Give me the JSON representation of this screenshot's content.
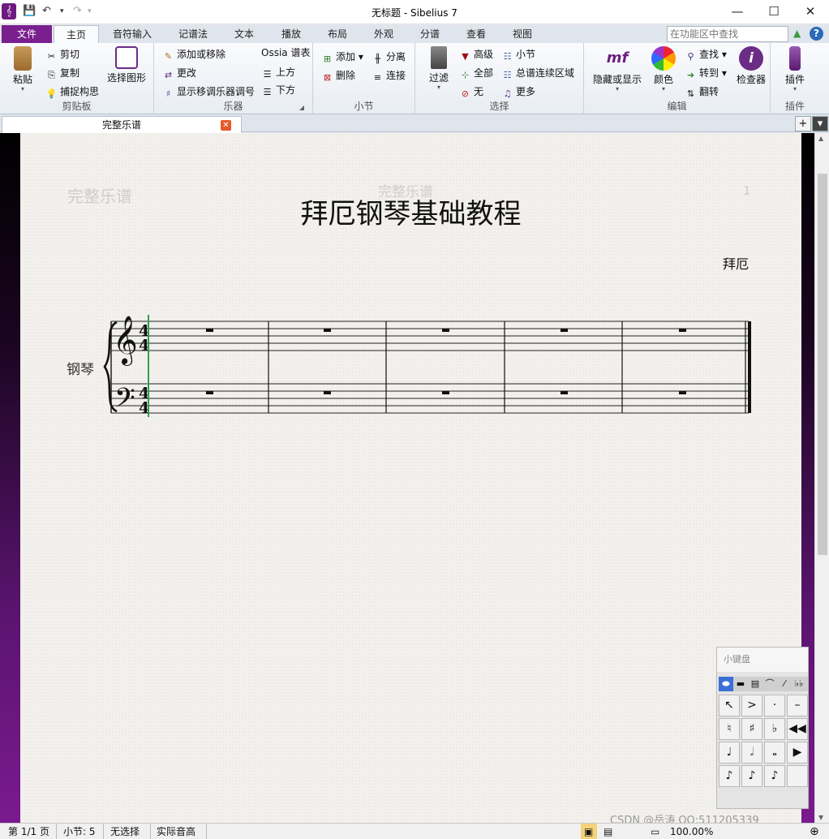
{
  "window": {
    "title": "无标题 - Sibelius 7",
    "minimize": "—",
    "maximize": "☐",
    "close": "✕"
  },
  "quick_access": {
    "undo_dd": "▾",
    "redo_dd": "▾",
    "more_dd": "▾"
  },
  "ribbon_tabs": {
    "file": "文件",
    "items": [
      "主页",
      "音符输入",
      "记谱法",
      "文本",
      "播放",
      "布局",
      "外观",
      "分谱",
      "查看",
      "视图"
    ],
    "active_index": 0
  },
  "search": {
    "placeholder": "在功能区中查找"
  },
  "groups": {
    "clipboard": {
      "label": "剪贴板",
      "paste": "粘贴",
      "cut": "剪切",
      "copy": "复制",
      "capture": "捕捉构思",
      "select_graphic": "选择图形"
    },
    "instruments": {
      "label": "乐器",
      "add_remove": "添加或移除",
      "change": "更改",
      "show_transposing": "显示移调乐器调号",
      "ossia": "Ossia 谱表",
      "above": "上方",
      "below": "下方"
    },
    "bars": {
      "label": "小节",
      "add": "添加",
      "delete": "删除",
      "split": "分离",
      "join": "连接"
    },
    "select": {
      "label": "选择",
      "filter": "过滤",
      "advanced": "高级",
      "all": "全部",
      "none": "无",
      "bar": "小节",
      "system_passage": "总谱连续区域",
      "more": "更多"
    },
    "edit": {
      "label": "编辑",
      "hide_show": "隐藏或显示",
      "color": "颜色",
      "find": "查找",
      "goto": "转到",
      "flip": "翻转",
      "inspector": "检查器"
    },
    "plugins": {
      "label": "插件",
      "plugins": "插件"
    }
  },
  "document_tab": {
    "label": "完整乐谱",
    "close": "✕",
    "add": "+",
    "menu": "▾"
  },
  "score": {
    "header_left": "完整乐谱",
    "header_center": "完整乐谱",
    "page_number": "1",
    "title": "拜厄钢琴基础教程",
    "composer": "拜厄",
    "instrument": "钢琴",
    "bars": 5
  },
  "keypad": {
    "title": "小键盘",
    "tabs": [
      "⬬",
      "▬",
      "▤",
      "⌒",
      "⁄",
      "♭♭"
    ],
    "keys": [
      "↖",
      ">",
      "·",
      "–",
      "♮",
      "♯",
      "♭",
      "◀◀",
      "♩",
      "𝅗𝅥",
      "𝅝",
      "▶",
      "♪",
      "♪",
      "♪",
      "",
      "𝄽 𝄾",
      "",
      ".",
      "⌒"
    ]
  },
  "statusbar": {
    "page": "第 1/1 页",
    "bar": "小节: 5",
    "selection": "无选择",
    "pitch": "实际音高",
    "zoom": "100.00%"
  },
  "watermark": "CSDN @岳涛  QQ:511205339",
  "colors": {
    "accent": "#7a1f8e",
    "cursor_green": "#2e9e4a"
  }
}
